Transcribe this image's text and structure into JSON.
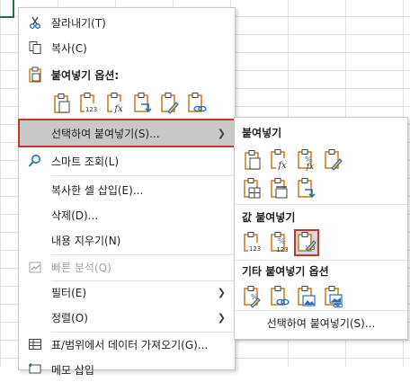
{
  "menu": {
    "cut": "잘라내기(T)",
    "copy": "복사(C)",
    "paste_options_header": "붙여넣기 옵션:",
    "paste_special": "선택하여 붙여넣기(S)...",
    "smart_lookup": "스마트 조회(L)",
    "insert_copied": "복사한 셀 삽입(E)...",
    "delete": "삭제(D)...",
    "clear_contents": "내용 지우기(N)",
    "quick_analysis": "빠른 분석(Q)",
    "filter": "필터(E)",
    "sort": "정렬(O)",
    "get_data": "표/범위에서 데이터 가져오기(G)...",
    "cut_off_item": "메모 삽입"
  },
  "submenu": {
    "paste_header": "붙여넣기",
    "values_header": "값 붙여넣기",
    "other_header": "기타 붙여넣기 옵션",
    "paste_special_link": "선택하여 붙여넣기(S)..."
  },
  "icon_labels": {
    "values_num": "123",
    "fx": "fx",
    "percent": "%"
  },
  "colors": {
    "highlight_border": "#c0392b",
    "highlight_bg": "#c8c8c8",
    "clipboard_orange": "#c27a22",
    "accent_blue": "#2b6fb6"
  }
}
